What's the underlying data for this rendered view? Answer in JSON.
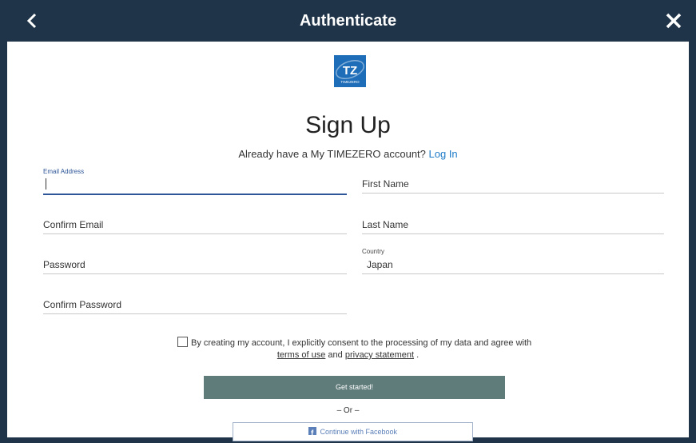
{
  "window": {
    "title": "Authenticate",
    "back_icon": "back-chevron-icon",
    "close_icon": "close-icon"
  },
  "logo": {
    "text": "TZ",
    "subtext": "TIMEZERO"
  },
  "heading": "Sign Up",
  "account_prompt": {
    "text": "Already have a My TIMEZERO account?",
    "link": "Log In"
  },
  "form": {
    "email": {
      "label": "Email Address",
      "value": ""
    },
    "confirm_email": {
      "label": "Confirm Email",
      "value": ""
    },
    "password": {
      "label": "Password",
      "value": ""
    },
    "confirm_password": {
      "label": "Confirm Password",
      "value": ""
    },
    "first_name": {
      "label": "First Name",
      "value": ""
    },
    "last_name": {
      "label": "Last Name",
      "value": ""
    },
    "country": {
      "label": "Country",
      "value": "Japan"
    }
  },
  "consent": {
    "checked": false,
    "text": "By creating my account, I explicitly consent to the processing of my data and agree with",
    "terms_link": "terms of use",
    "and": "and",
    "privacy_link": "privacy statement",
    "end": "."
  },
  "actions": {
    "get_started": "Get started!",
    "or": "– Or –",
    "facebook": "Continue with Facebook"
  },
  "colors": {
    "titlebar": "#1f3448",
    "active_underline": "#2d5597",
    "link": "#1e7bc8",
    "button": "#5f7b7a",
    "facebook": "#5b7fb8"
  }
}
